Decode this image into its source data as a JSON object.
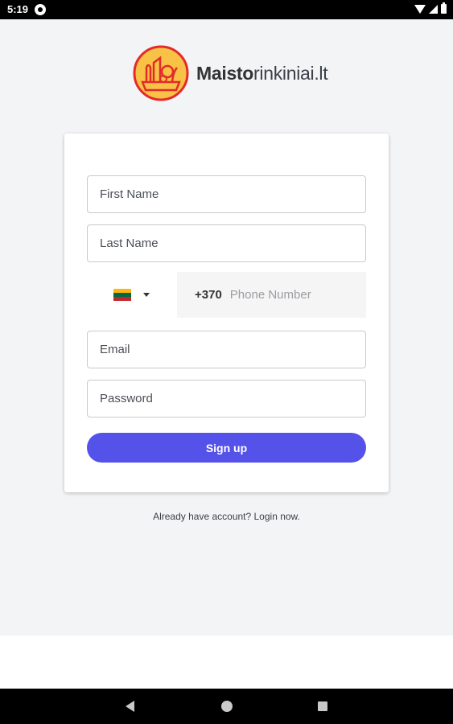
{
  "status_bar": {
    "time": "5:19"
  },
  "brand": {
    "name_bold": "Maisto",
    "name_rest": "rinkiniai.lt"
  },
  "form": {
    "first_name_placeholder": "First Name",
    "last_name_placeholder": "Last Name",
    "country_flag": "lithuania-flag-icon",
    "phone_prefix": "+370",
    "phone_placeholder": "Phone Number",
    "email_placeholder": "Email",
    "password_placeholder": "Password",
    "signup_label": "Sign up"
  },
  "footer": {
    "login_text": "Already have account? Login now."
  },
  "colors": {
    "accent": "#5552ea",
    "background": "#f3f4f6",
    "logo_orange": "#f7c245",
    "logo_red": "#e42b2b"
  }
}
